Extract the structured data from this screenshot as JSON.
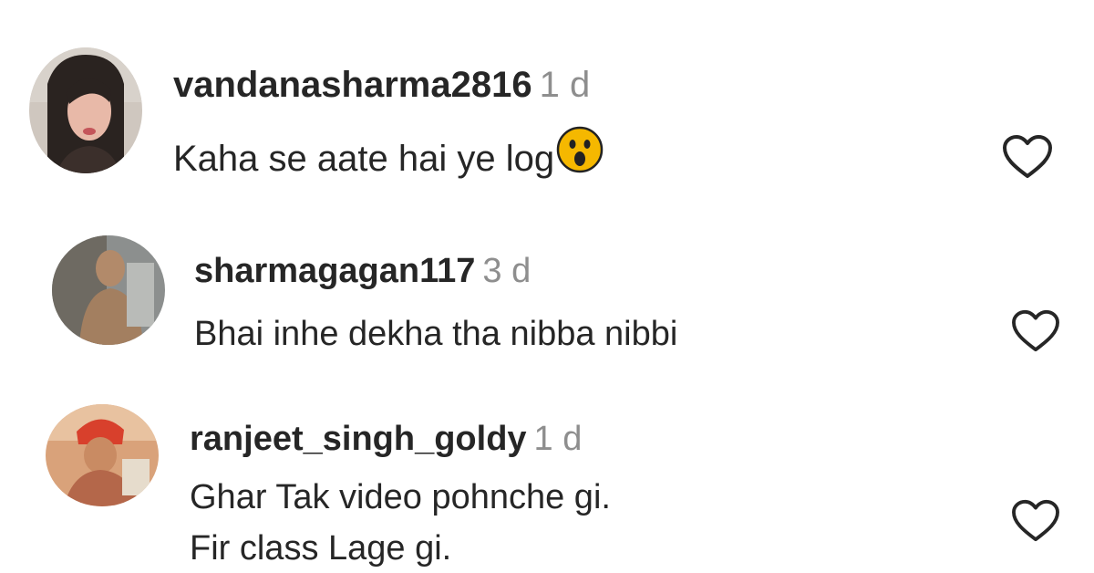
{
  "comments": [
    {
      "username": "vandanasharma2816",
      "time": "1 d",
      "text": "Kaha se aate hai ye log",
      "emoji": "astonished-face-emoji",
      "avatar": "user-photo-avatar"
    },
    {
      "username": "sharmagagan117",
      "time": "3 d",
      "text": "Bhai inhe dekha tha nibba nibbi",
      "avatar": "user-photo-avatar"
    },
    {
      "username": "ranjeet_singh_goldy",
      "time": "1 d",
      "text_line1": "Ghar Tak video pohnche gi.",
      "text_line2": "Fir class Lage gi.",
      "avatar": "user-photo-avatar"
    }
  ],
  "icons": {
    "like": "heart-outline-icon"
  },
  "colors": {
    "text": "#262626",
    "secondary": "#8e8e8e",
    "emoji_yellow": "#f5b800"
  }
}
